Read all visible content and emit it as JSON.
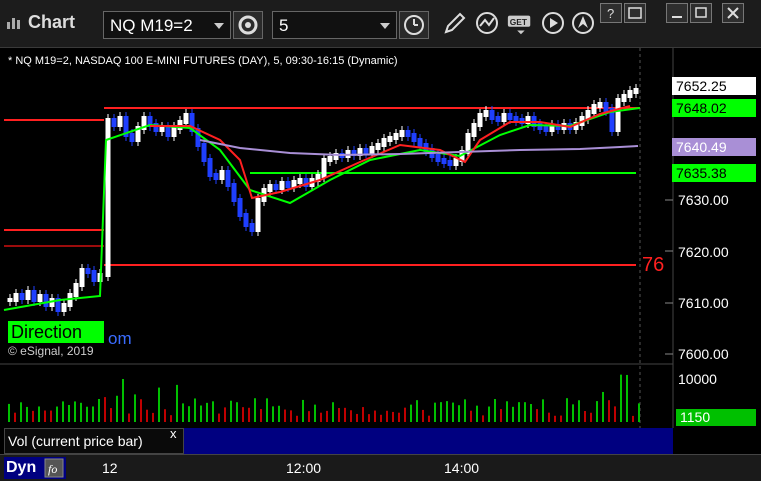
{
  "window": {
    "title": "Chart",
    "symbol": "NQ M19=2",
    "interval": "5",
    "minimize": "–",
    "restore": "□",
    "close": "✕"
  },
  "status": {
    "info": "* NQ M19=2, NASDAQ 100 E-MINI FUTURES (DAY), 5, 09:30-16:15 (Dynamic)"
  },
  "price_labels": [
    {
      "text": "7652.25",
      "bg": "#ffffff",
      "fg": "#000000"
    },
    {
      "text": "7648.02",
      "bg": "#00ff00",
      "fg": "#000000"
    },
    {
      "text": "7640.49",
      "bg": "#a98fd6",
      "fg": "#ffffff"
    },
    {
      "text": "7635.38",
      "bg": "#00ff00",
      "fg": "#000000"
    }
  ],
  "price_axis": [
    "7630.00",
    "7620.00",
    "7610.00",
    "7600.00"
  ],
  "red_line_label": "76",
  "direction_label": "Direction",
  "direction_suffix": "om",
  "copyright": "© eSignal, 2019",
  "volume": {
    "axis_label": "10000",
    "current_label": "1150",
    "panel_label": "Vol (current price bar)",
    "close_label": "x"
  },
  "bottom": {
    "dyn_label": "Dyn",
    "times": [
      "12",
      "12:00",
      "14:00"
    ]
  },
  "colors": {
    "up_candle": "#ffffff",
    "down_candle": "#1f3fff",
    "ma_green": "#00ff00",
    "ma_red": "#ff2020",
    "ma_purple": "#a98fd6",
    "vol_green": "#00c000",
    "vol_red": "#c00000"
  }
}
